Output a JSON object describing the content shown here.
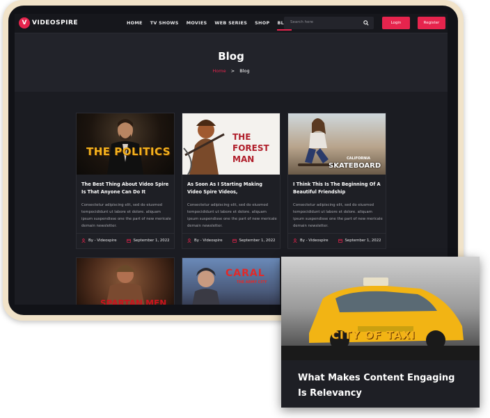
{
  "brand": {
    "badge": "V",
    "name": "VIDEOSPIRE"
  },
  "nav": {
    "items": [
      {
        "label": "HOME"
      },
      {
        "label": "TV SHOWS"
      },
      {
        "label": "MOVIES"
      },
      {
        "label": "WEB SERIES"
      },
      {
        "label": "SHOP"
      },
      {
        "label": "BLOG",
        "active": true
      }
    ],
    "search_placeholder": "Search here",
    "login_label": "Login",
    "register_label": "Register"
  },
  "hero": {
    "title": "Blog",
    "breadcrumb": {
      "home": "Home",
      "separator": ">",
      "current": "Blog"
    }
  },
  "cards": [
    {
      "image_caption": "THE POLITICS",
      "title": "The Best Thing About Video Spire Is That Anyone Can Do It",
      "excerpt": "Consectetur adipiscing elit, sed do eiusmod tempocididunt ut labore et dolore. aliquam ipsum suspendisse one the part of new mericale demain newsletter.",
      "author": "By - Videospire",
      "date": "September 1, 2022"
    },
    {
      "image_caption": "THE FOREST MAN",
      "title": "As Soon As I Starting Making Video Spire Videos,",
      "excerpt": "Consectetur adipiscing elit, sed do eiusmod tempocididunt ut labore et dolore. aliquam ipsum suspendisse one the part of new mericale demain newsletter.",
      "author": "By - Videospire",
      "date": "September 1, 2022"
    },
    {
      "image_caption": "SKATEBOARD",
      "image_caption_top": "CALIFORNIA",
      "title": "I Think This Is The Beginning Of A Beautiful Friendship",
      "excerpt": "Consectetur adipiscing elit, sed do eiusmod tempocididunt ut labore et dolore. aliquam ipsum suspendisse one the part of new mericale demain newsletter.",
      "author": "By - Videospire",
      "date": "September 1, 2022"
    },
    {
      "image_caption": "SPARTAN MEN"
    },
    {
      "image_caption": "CARAL",
      "image_caption_sub": "THE ARMY CITY"
    }
  ],
  "overlay": {
    "image_caption": "CITY OF TAXI",
    "title": "What Makes Content Engaging Is Relevancy"
  },
  "colors": {
    "accent": "#e6244d",
    "background": "#1b1c22",
    "frame": "#f1e3c9"
  },
  "icons": {
    "author": "user-icon",
    "date": "calendar-icon",
    "search": "search-icon"
  }
}
